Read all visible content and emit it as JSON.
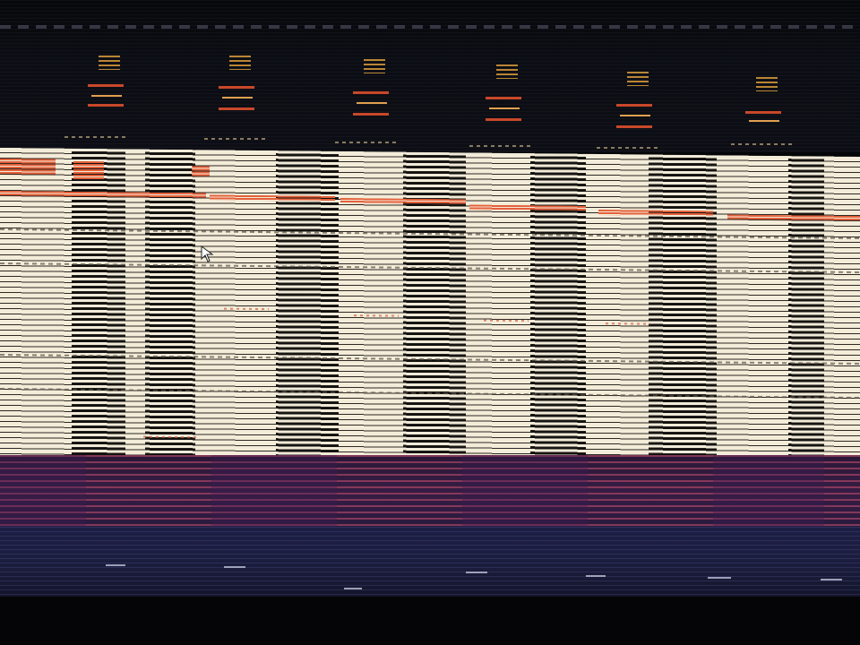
{
  "screen": {
    "state": "corrupted",
    "cursor": "arrow-cursor",
    "colors": {
      "background": "#050608",
      "panel": "#efe8d4",
      "scanline": "#1a1714",
      "accent_orange": "#e4603a",
      "heading_glyph": "#d99a3a",
      "band_purple": "#361c44",
      "band_blue": "#1d1e44"
    }
  }
}
